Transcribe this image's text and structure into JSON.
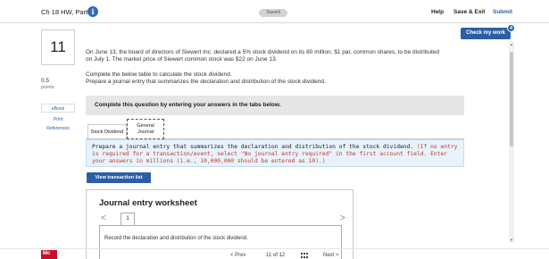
{
  "header": {
    "title": "Ch 18 HW, Part 1",
    "info_icon": "i",
    "saved_label": "Saved",
    "help_label": "Help",
    "save_exit_label": "Save & Exit",
    "submit_label": "Submit",
    "check_work_label": "Check my work",
    "check_work_count": "4"
  },
  "question": {
    "number": "11",
    "points_value": "0.5",
    "points_label": "points",
    "text": "On June 13, the board of directors of Siewert Inc. declared a 5% stock dividend on its 80 million, $1 par, common shares, to be distributed on July 1. The market price of Siewert common stock was $22 on June 13.",
    "instruction_1": "Complete the below table to calculate the stock dividend.",
    "instruction_2": "Prepare a journal entry that summarizes the declaration and distribution of the stock dividend."
  },
  "sidebar": {
    "links": [
      "eBook",
      "Print",
      "References"
    ]
  },
  "complete_bar": "Complete this question by entering your answers in the tabs below.",
  "tabs": [
    {
      "label": "Stock Dividend"
    },
    {
      "label_line1": "General",
      "label_line2": "Journal"
    }
  ],
  "prepare": {
    "main": "Prepare a journal entry that summarizes the declaration and distribution of the stock dividend.",
    "note": "(If no entry is required for a transaction/event, select \"No journal entry required\" in the first account field. Enter your answers in millions (i.e., 10,000,000 should be entered as 10).)"
  },
  "view_transaction_label": "View transaction list",
  "worksheet": {
    "title": "Journal entry worksheet",
    "prev": "<",
    "next": ">",
    "page": "1",
    "record_text": "Record the declaration and distribution of the stock dividend."
  },
  "footer": {
    "logo": "Mc Graw Hill",
    "prev_label": "< Prev",
    "position": "11 of 12",
    "next_label": "Next >"
  },
  "colors": {
    "accent": "#2b5ea7",
    "note_red": "#c0392b",
    "logo_red": "#c8102e"
  }
}
